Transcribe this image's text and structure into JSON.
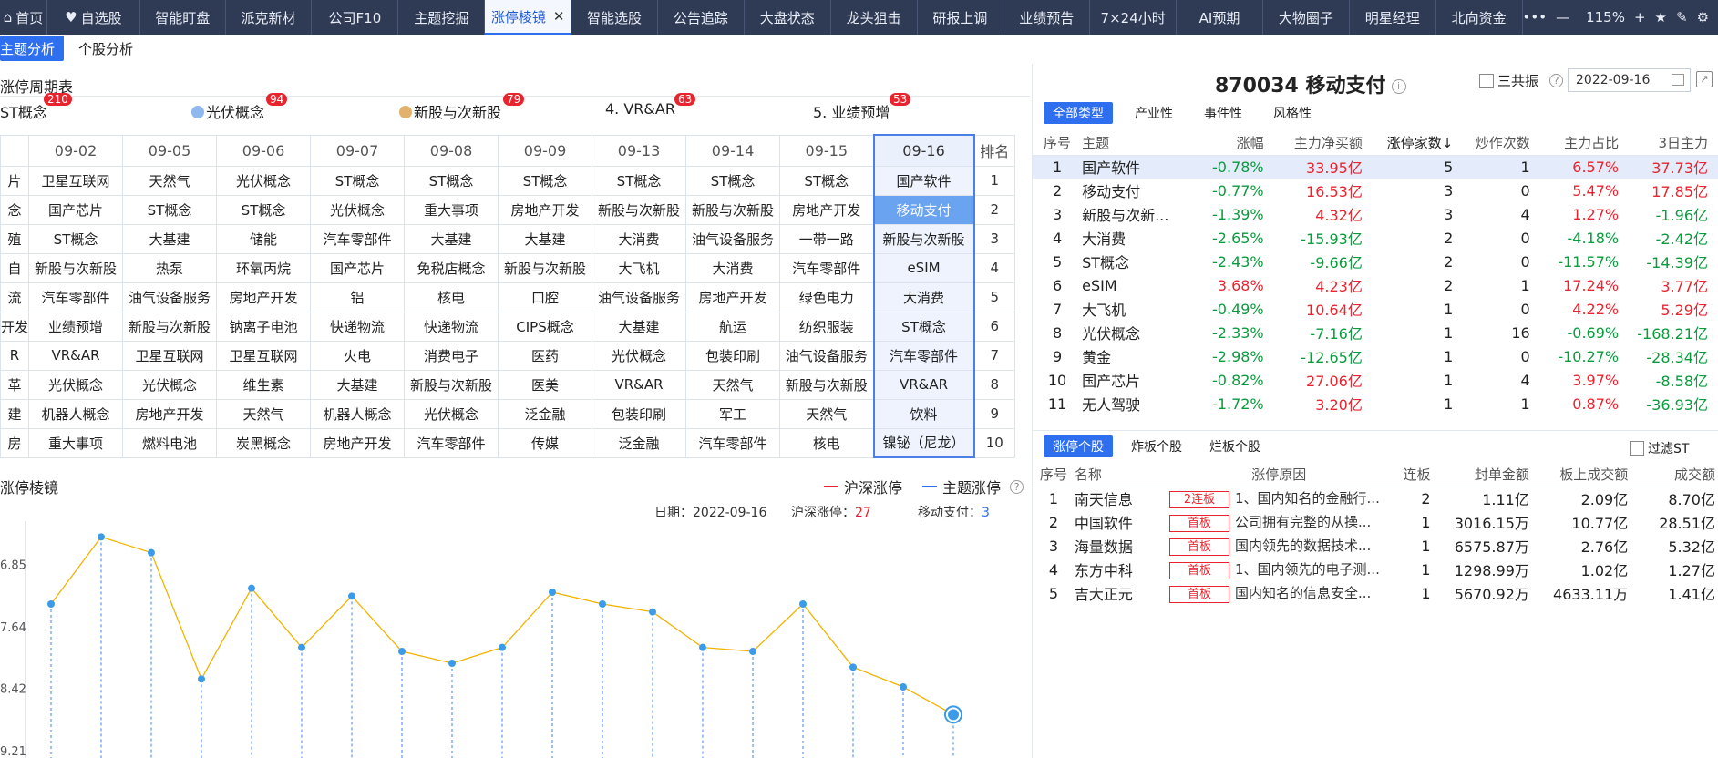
{
  "nav": {
    "tabs": [
      "首页",
      "自选股",
      "智能盯盘",
      "派克新材",
      "公司F10",
      "主题挖掘",
      "涨停棱镜",
      "智能选股",
      "公告追踪",
      "大盘状态",
      "龙头狙击",
      "研报上调",
      "业绩预告",
      "7×24小时",
      "AI预期",
      "大物圈子",
      "明星经理",
      "北向资金"
    ],
    "active_tab": "涨停棱镜",
    "more": "•••",
    "zoom_minus": "—",
    "zoom": "115%",
    "zoom_plus": "+"
  },
  "subtabs": [
    "主题分析",
    "个股分析"
  ],
  "cycle": {
    "title": "涨停周期表",
    "concepts": [
      {
        "label": "ST概念",
        "count": "210"
      },
      {
        "label": "光伏概念",
        "count": "94"
      },
      {
        "label": "新股与次新股",
        "count": "79"
      },
      {
        "label": "4. VR&AR",
        "count": "63"
      },
      {
        "label": "5. 业绩预增",
        "count": "53"
      }
    ],
    "dates": [
      "",
      "09-02",
      "09-05",
      "09-06",
      "09-07",
      "09-08",
      "09-09",
      "09-13",
      "09-14",
      "09-15",
      "09-16"
    ],
    "rank_header": "排名",
    "rows": [
      [
        "片",
        "卫星互联网",
        "天然气",
        "光伏概念",
        "ST概念",
        "ST概念",
        "ST概念",
        "ST概念",
        "ST概念",
        "ST概念",
        "国产软件",
        "1"
      ],
      [
        "念",
        "国产芯片",
        "ST概念",
        "ST概念",
        "光伏概念",
        "重大事项",
        "房地产开发",
        "新股与次新股",
        "新股与次新股",
        "房地产开发",
        "移动支付",
        "2"
      ],
      [
        "殖",
        "ST概念",
        "大基建",
        "储能",
        "汽车零部件",
        "大基建",
        "大基建",
        "大消费",
        "油气设备服务",
        "一带一路",
        "新股与次新股",
        "3"
      ],
      [
        "自",
        "新股与次新股",
        "热泵",
        "环氧丙烷",
        "国产芯片",
        "免税店概念",
        "新股与次新股",
        "大飞机",
        "大消费",
        "汽车零部件",
        "eSIM",
        "4"
      ],
      [
        "流",
        "汽车零部件",
        "油气设备服务",
        "房地产开发",
        "铝",
        "核电",
        "口腔",
        "油气设备服务",
        "房地产开发",
        "绿色电力",
        "大消费",
        "5"
      ],
      [
        "开发",
        "业绩预增",
        "新股与次新股",
        "钠离子电池",
        "快递物流",
        "快递物流",
        "CIPS概念",
        "大基建",
        "航运",
        "纺织服装",
        "ST概念",
        "6"
      ],
      [
        "R",
        "VR&AR",
        "卫星互联网",
        "卫星互联网",
        "火电",
        "消费电子",
        "医药",
        "光伏概念",
        "包装印刷",
        "油气设备服务",
        "汽车零部件",
        "7"
      ],
      [
        "革",
        "光伏概念",
        "光伏概念",
        "维生素",
        "大基建",
        "新股与次新股",
        "医美",
        "VR&AR",
        "天然气",
        "新股与次新股",
        "VR&AR",
        "8"
      ],
      [
        "建",
        "机器人概念",
        "房地产开发",
        "天然气",
        "机器人概念",
        "光伏概念",
        "泛金融",
        "包装印刷",
        "军工",
        "天然气",
        "饮料",
        "9"
      ],
      [
        "房",
        "重大事项",
        "燃料电池",
        "炭黑概念",
        "房地产开发",
        "汽车零部件",
        "传媒",
        "泛金融",
        "汽车零部件",
        "核电",
        "镍铋（尼龙）",
        "10"
      ]
    ]
  },
  "prism": {
    "title": "涨停棱镜",
    "legend_hs": "沪深涨停",
    "legend_topic": "主题涨停",
    "date_label": "日期：",
    "date_value": "2022-09-16",
    "hs_label": "沪深涨停：",
    "hs_value": "27",
    "topic_label": "移动支付：",
    "topic_value": "3",
    "y_ticks": [
      "6.85",
      "7.64",
      "8.42",
      "9.21"
    ],
    "colors": {
      "line": "#f2b300",
      "drop": "#3b82f0",
      "hs": "#e8242f",
      "topic": "#2e6ff0"
    }
  },
  "chart_data": {
    "type": "line",
    "y_inverted": true,
    "ylim": [
      6.3,
      9.3
    ],
    "y_ticks": [
      6.85,
      7.64,
      8.42,
      9.21
    ],
    "values": [
      7.35,
      6.5,
      6.7,
      8.3,
      7.15,
      7.9,
      7.25,
      7.95,
      8.1,
      7.9,
      7.2,
      7.35,
      7.45,
      7.9,
      7.95,
      7.35,
      8.15,
      8.4,
      8.75
    ]
  },
  "stock": {
    "title": "870034 移动支付",
    "info": "i",
    "resonance": "三共振",
    "help": "?",
    "date": "2022-09-16",
    "ext": "↗"
  },
  "filter_tabs": [
    "全部类型",
    "产业性",
    "事件性",
    "风格性"
  ],
  "topic_table": {
    "headers": [
      "序号",
      "主题",
      "涨幅",
      "主力净买额",
      "涨停家数↓",
      "炒作次数",
      "主力占比",
      "3日主力"
    ],
    "rows": [
      [
        "1",
        "国产软件",
        "-0.78%",
        "33.95亿",
        "5",
        "1",
        "6.57%",
        "37.73亿"
      ],
      [
        "2",
        "移动支付",
        "-0.77%",
        "16.53亿",
        "3",
        "0",
        "5.47%",
        "17.85亿"
      ],
      [
        "3",
        "新股与次新...",
        "-1.39%",
        "4.32亿",
        "3",
        "4",
        "1.27%",
        "-1.96亿"
      ],
      [
        "4",
        "大消费",
        "-2.65%",
        "-15.93亿",
        "2",
        "0",
        "-4.18%",
        "-2.42亿"
      ],
      [
        "5",
        "ST概念",
        "-2.43%",
        "-9.66亿",
        "2",
        "0",
        "-11.57%",
        "-14.39亿"
      ],
      [
        "6",
        "eSIM",
        "3.68%",
        "4.23亿",
        "2",
        "1",
        "17.24%",
        "3.77亿"
      ],
      [
        "7",
        "大飞机",
        "-0.49%",
        "10.64亿",
        "1",
        "0",
        "4.22%",
        "5.29亿"
      ],
      [
        "8",
        "光伏概念",
        "-2.33%",
        "-7.16亿",
        "1",
        "16",
        "-0.69%",
        "-168.21亿"
      ],
      [
        "9",
        "黄金",
        "-2.98%",
        "-12.65亿",
        "1",
        "0",
        "-10.27%",
        "-28.34亿"
      ],
      [
        "10",
        "国产芯片",
        "-0.82%",
        "27.06亿",
        "1",
        "4",
        "3.97%",
        "-8.58亿"
      ],
      [
        "11",
        "无人驾驶",
        "-1.72%",
        "3.20亿",
        "1",
        "1",
        "0.87%",
        "-36.93亿"
      ]
    ]
  },
  "limit_tabs": [
    "涨停个股",
    "炸板个股",
    "烂板个股"
  ],
  "filter_st": "过滤ST",
  "stock_table": {
    "headers": [
      "序号",
      "名称",
      "涨停原因",
      "连板",
      "封单金额",
      "板上成交额",
      "成交额"
    ],
    "rows": [
      [
        "1",
        "南天信息",
        "2连板",
        "1、国内知名的金融行...",
        "2",
        "1.11亿",
        "2.09亿",
        "8.70亿"
      ],
      [
        "2",
        "中国软件",
        "首板",
        "公司拥有完整的从操...",
        "1",
        "3016.15万",
        "10.77亿",
        "28.51亿"
      ],
      [
        "3",
        "海量数据",
        "首板",
        "国内领先的数据技术...",
        "1",
        "6575.87万",
        "2.76亿",
        "5.32亿"
      ],
      [
        "4",
        "东方中科",
        "首板",
        "1、国内领先的电子测...",
        "1",
        "1298.99万",
        "1.02亿",
        "1.27亿"
      ],
      [
        "5",
        "吉大正元",
        "首板",
        "国内知名的信息安全...",
        "1",
        "5670.92万",
        "4633.11万",
        "1.41亿"
      ]
    ]
  }
}
